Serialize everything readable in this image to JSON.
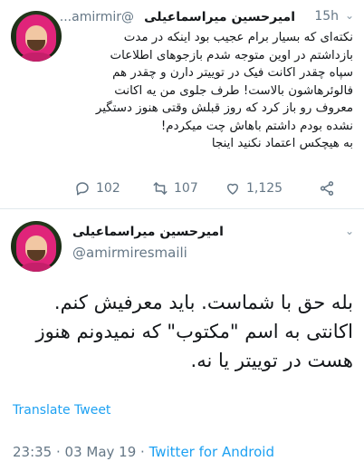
{
  "tweet1": {
    "display_name": "امیرحسین میراسماعیلی",
    "handle": "@amirmir...",
    "time": "15h",
    "lines": [
      "نکته‌ای که بسیار برام عجیب بود اینکه در مدت",
      "بازداشتم در اوین متوجه شدم بازجوهای اطلاعات",
      "سپاه چقدر اکانت فیک در توییتر دارن و چقدر هم",
      "فالوئرهاشون بالاست! طرف جلوی من یه اکانت",
      "معروف رو باز کرد که روز قبلش وقتی هنوز دستگیر",
      "نشده بودم داشتم باهاش چت میکردم!",
      "به هیچکس اعتماد نکنید اینجا"
    ],
    "actions": {
      "reply_count": "102",
      "retweet_count": "107",
      "like_count": "1,125"
    }
  },
  "tweet2": {
    "display_name": "امیرحسین میراسماعیلی",
    "handle": "@amirmiresmaili",
    "lines": [
      "بله حق با شماست. باید معرفیش کنم.",
      "اکانتی به اسم \"مکتوب\" که نمیدونم هنوز",
      "هست در توییتر یا نه."
    ],
    "translate_label": "Translate Tweet",
    "timestamp": "23:35 · 03 May 19 · ",
    "source": "Twitter for Android"
  },
  "colors": {
    "link": "#1da1f2",
    "muted": "#657786",
    "separator": "#e1e8ed"
  },
  "icons": [
    "reply-icon",
    "retweet-icon",
    "heart-icon",
    "share-icon",
    "chevron-down-icon"
  ]
}
